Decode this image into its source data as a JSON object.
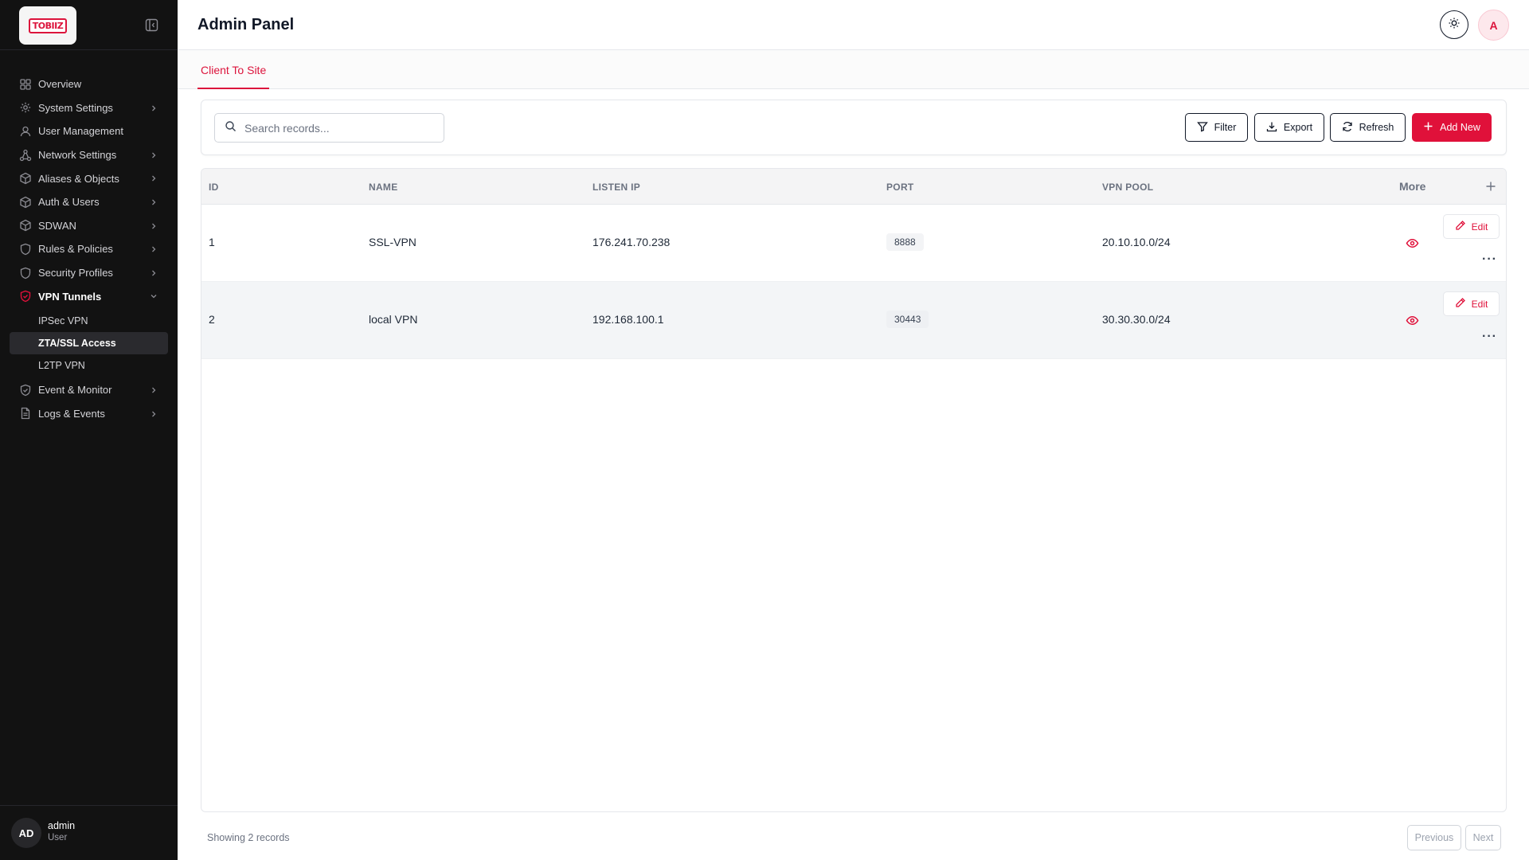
{
  "app": {
    "logo_text": "TOBIIZ",
    "title": "Admin Panel",
    "user_initial": "A"
  },
  "sidebar": {
    "items": [
      {
        "label": "Overview",
        "icon": "grid-icon",
        "has_chevron": false
      },
      {
        "label": "System Settings",
        "icon": "gear-icon",
        "has_chevron": true
      },
      {
        "label": "User Management",
        "icon": "user-icon",
        "has_chevron": false
      },
      {
        "label": "Network Settings",
        "icon": "network-icon",
        "has_chevron": true
      },
      {
        "label": "Aliases & Objects",
        "icon": "box-icon",
        "has_chevron": true
      },
      {
        "label": "Auth & Users",
        "icon": "box-icon",
        "has_chevron": true
      },
      {
        "label": "SDWAN",
        "icon": "box-icon",
        "has_chevron": true
      },
      {
        "label": "Rules & Policies",
        "icon": "shield-icon",
        "has_chevron": true
      },
      {
        "label": "Security Profiles",
        "icon": "shield-icon",
        "has_chevron": true
      },
      {
        "label": "VPN Tunnels",
        "icon": "shield-check-icon",
        "has_chevron": true,
        "expanded": true
      },
      {
        "label": "Event & Monitor",
        "icon": "shield-check-icon",
        "has_chevron": true
      },
      {
        "label": "Logs & Events",
        "icon": "document-icon",
        "has_chevron": true
      }
    ],
    "vpn_subitems": [
      "IPSec VPN",
      "ZTA/SSL Access",
      "L2TP VPN"
    ],
    "active_subitem": "ZTA/SSL Access",
    "footer": {
      "avatar": "AD",
      "name": "admin",
      "role": "User"
    }
  },
  "tabs": [
    {
      "label": "Client To Site",
      "active": true
    }
  ],
  "toolbar": {
    "search_placeholder": "Search records...",
    "filter_label": "Filter",
    "export_label": "Export",
    "refresh_label": "Refresh",
    "add_label": "Add New"
  },
  "table": {
    "columns": [
      "ID",
      "NAME",
      "LISTEN IP",
      "PORT",
      "VPN POOL"
    ],
    "more_label": "More",
    "edit_label": "Edit",
    "rows": [
      {
        "id": "1",
        "name": "SSL-VPN",
        "listen_ip": "176.241.70.238",
        "port": "8888",
        "vpn_pool": "20.10.10.0/24"
      },
      {
        "id": "2",
        "name": "local VPN",
        "listen_ip": "192.168.100.1",
        "port": "30443",
        "vpn_pool": "30.30.30.0/24"
      }
    ]
  },
  "footer": {
    "records_text": "Showing 2 records",
    "previous_label": "Previous",
    "next_label": "Next"
  },
  "colors": {
    "accent": "#e0113a",
    "sidebar_bg": "#121212"
  }
}
